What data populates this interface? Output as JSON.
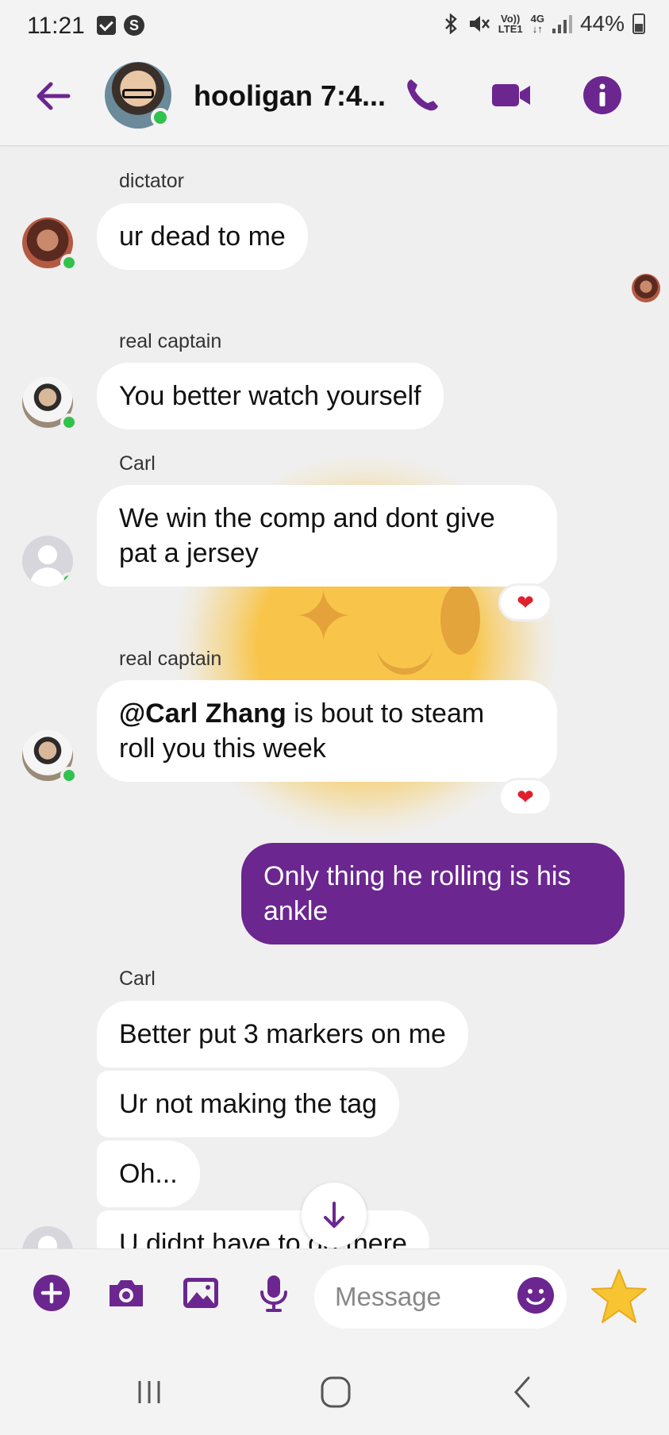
{
  "status_bar": {
    "time": "11:21",
    "network_top": "Vo))",
    "network_bottom": "LTE1",
    "data_top": "4G",
    "data_bottom": "↓↑",
    "battery": "44%"
  },
  "header": {
    "title": "hooligan 7:4...",
    "accent_color": "#6b2690"
  },
  "messages": [
    {
      "sender": "dictator",
      "text": "ur dead to me"
    },
    {
      "sender": "real captain",
      "text": "You better watch yourself"
    },
    {
      "sender": "Carl",
      "text_line1": "We win the comp and dont give",
      "text_line2": "pat a jersey",
      "reaction": "❤"
    },
    {
      "sender": "real captain",
      "mention": "@Carl Zhang",
      "text_rest": " is bout to steam",
      "text_line2": "roll you this week",
      "reaction": "❤"
    },
    {
      "outgoing": true,
      "text_line1": "Only thing he rolling is his",
      "text_line2": "ankle"
    },
    {
      "sender": "Carl",
      "text": "Better put 3 markers on me"
    },
    {
      "text": "Ur not making the tag"
    },
    {
      "text": "Oh..."
    },
    {
      "text": "U didnt have to go there"
    }
  ],
  "composer": {
    "placeholder": "Message"
  },
  "icons": {
    "back": "arrow-left-icon",
    "call": "phone-icon",
    "video": "video-camera-icon",
    "info": "info-icon",
    "plus": "plus-icon",
    "camera": "camera-icon",
    "gallery": "image-icon",
    "mic": "microphone-icon",
    "emoji": "smiley-icon",
    "star": "star-icon",
    "scroll_down": "arrow-down-icon"
  }
}
